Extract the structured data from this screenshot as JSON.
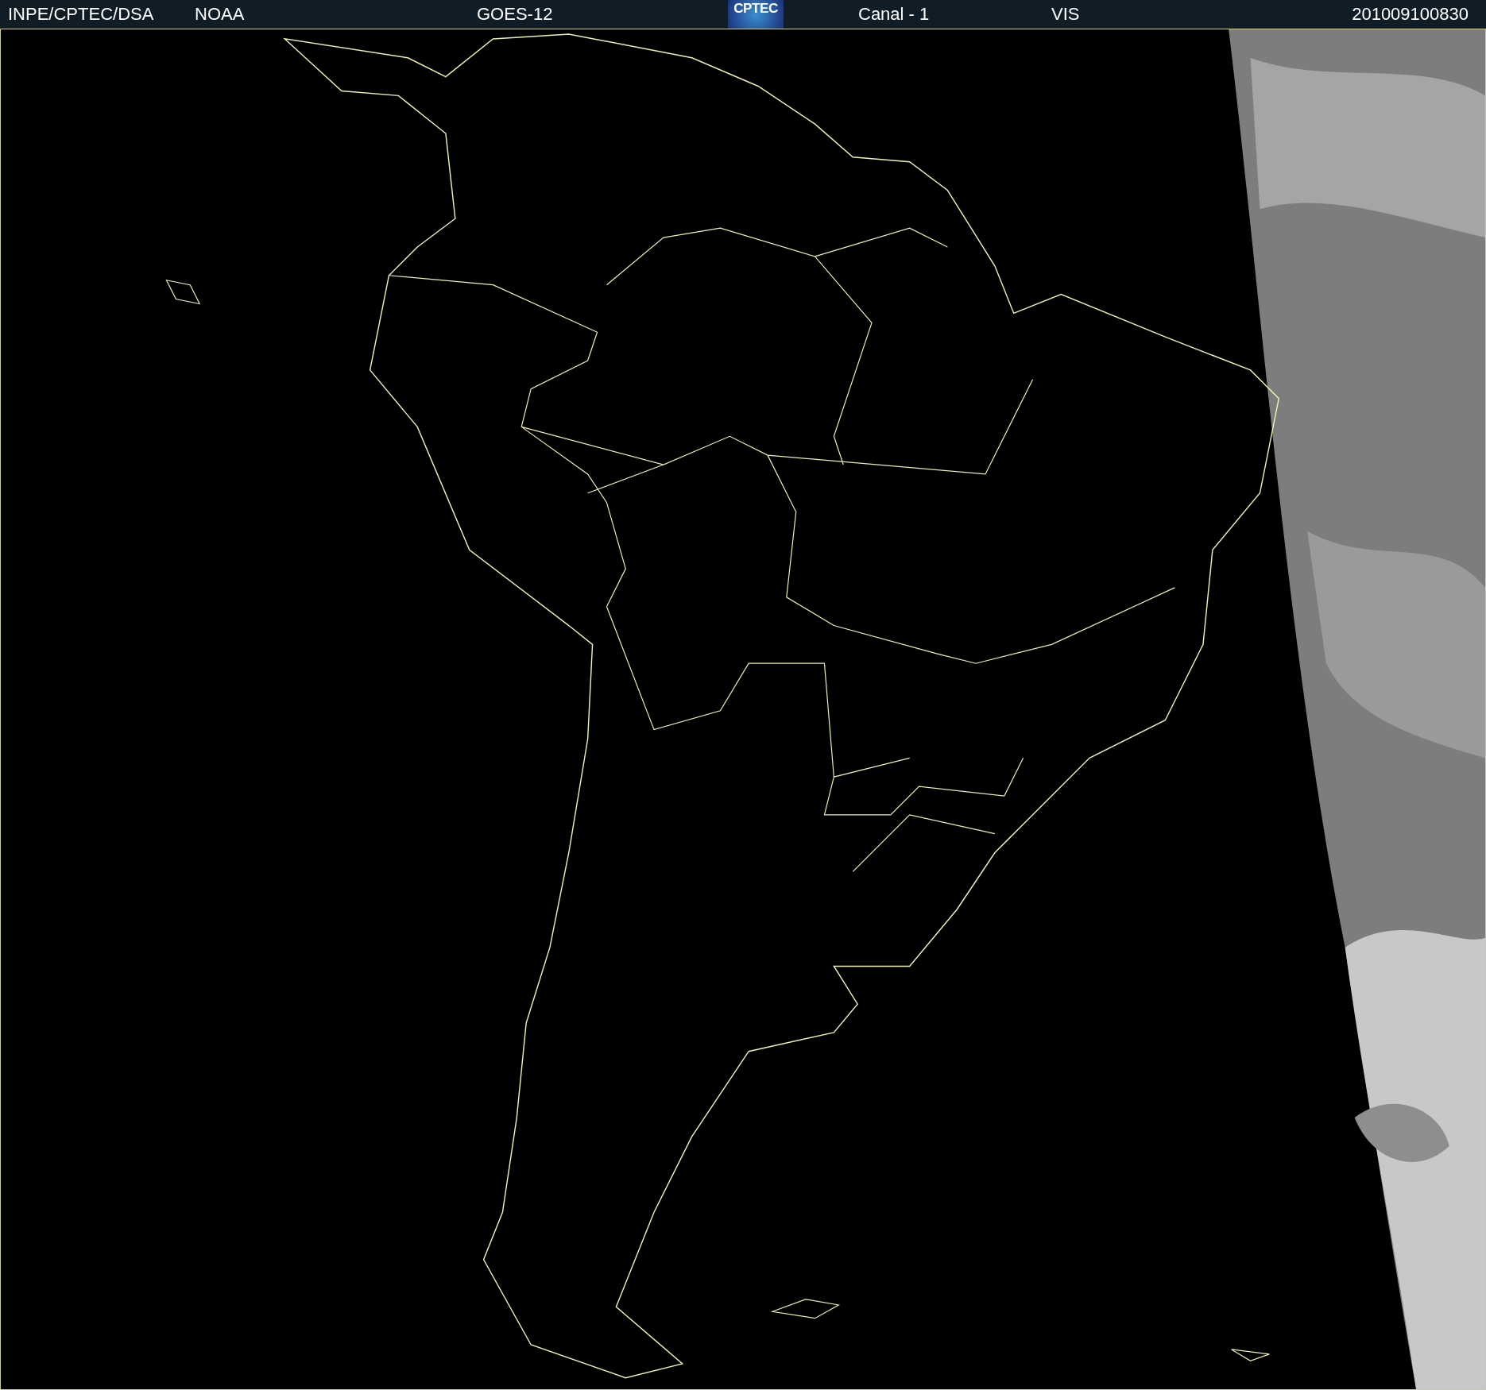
{
  "header": {
    "left": [
      "INPE/CPTEC/DSA",
      "NOAA"
    ],
    "satellite": "GOES-12",
    "logo": "CPTEC",
    "channel": "Canal - 1",
    "band": "VIS",
    "timestamp": "201009100830"
  }
}
